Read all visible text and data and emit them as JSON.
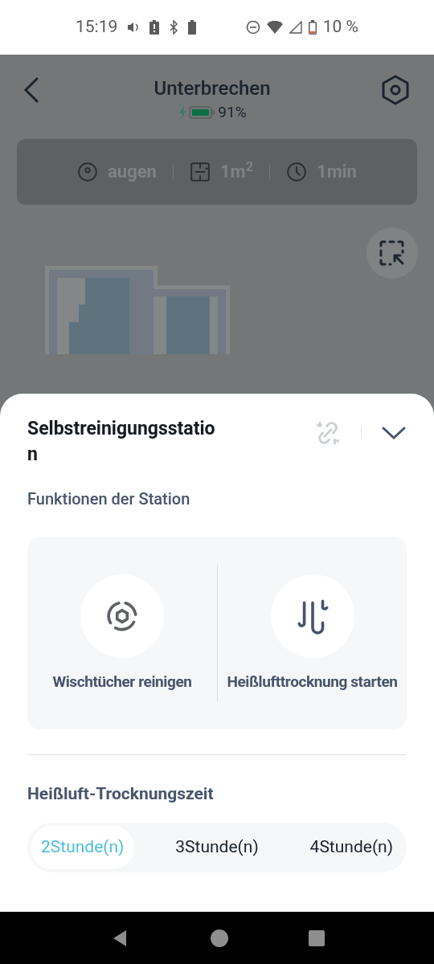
{
  "status_bar": {
    "time": "15:19",
    "battery": "10 %"
  },
  "header": {
    "title": "Unterbrechen",
    "battery": "91%"
  },
  "stats": [
    {
      "kind": "mode",
      "text": "augen"
    },
    {
      "kind": "area",
      "text": "1m$^{2}$"
    },
    {
      "kind": "time",
      "text": "1min"
    }
  ],
  "sheet": {
    "title": "Selbstreinigungsstation",
    "section": "Funktionen der Station",
    "actions": [
      {
        "kind": "mop",
        "label": "Wischtücher reinigen"
      },
      {
        "kind": "dry",
        "label": "Heißlufttrocknung starten"
      }
    ],
    "drying_title": "Heißluft-Trocknungszeit",
    "durations": [
      {
        "label": "2Stunde(n)",
        "selected": true
      },
      {
        "label": "3Stunde(n)",
        "selected": false
      },
      {
        "label": "4Stunde(n)",
        "selected": false
      }
    ]
  }
}
